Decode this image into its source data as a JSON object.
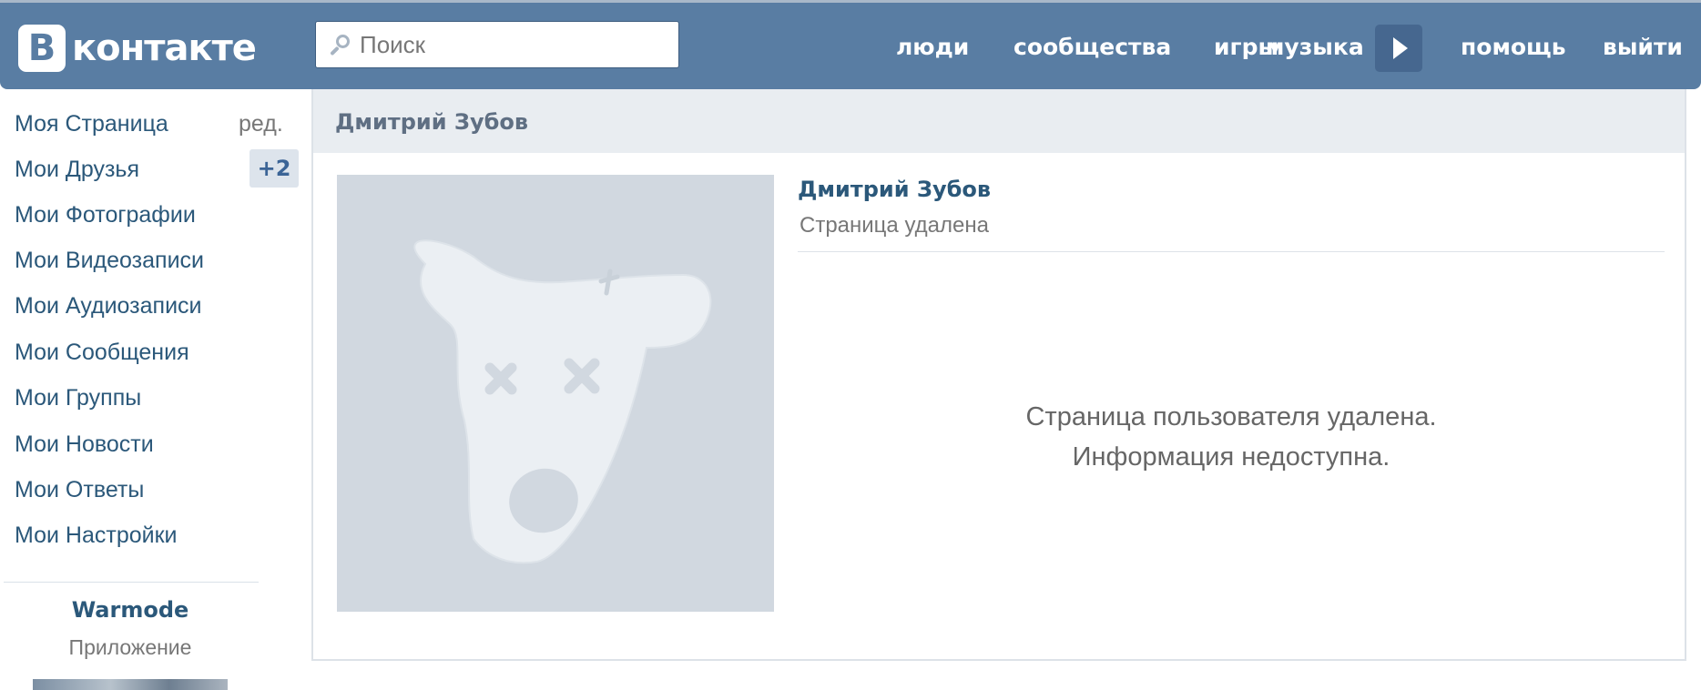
{
  "header": {
    "logo_letter": "В",
    "logo_text": "контакте",
    "search": {
      "placeholder": "Поиск"
    },
    "nav": {
      "people": "люди",
      "communities": "сообщества",
      "games": "игры",
      "music": "музыка",
      "help": "помощь",
      "logout": "выйти"
    },
    "play_icon": "play-icon"
  },
  "sidebar": {
    "items": [
      {
        "label": "Моя Страница"
      },
      {
        "label": "Мои Друзья"
      },
      {
        "label": "Мои Фотографии"
      },
      {
        "label": "Мои Видеозаписи"
      },
      {
        "label": "Мои Аудиозаписи"
      },
      {
        "label": "Мои Сообщения"
      },
      {
        "label": "Мои Группы"
      },
      {
        "label": "Мои Новости"
      },
      {
        "label": "Мои Ответы"
      },
      {
        "label": "Мои Настройки"
      }
    ],
    "edit_label": "ред.",
    "friends_badge": "+2",
    "app": {
      "name": "Warmode",
      "type": "Приложение"
    }
  },
  "main": {
    "header_title": "Дмитрий Зубов",
    "profile": {
      "name": "Дмитрий Зубов",
      "status": "Страница удалена"
    },
    "deleted_message": {
      "line1": "Страница пользователя удалена.",
      "line2": "Информация недоступна."
    }
  },
  "colors": {
    "header_bg": "#597da3",
    "link": "#2b587a",
    "avatar_bg": "#d1d8e0",
    "avatar_figure": "#ebeff3"
  }
}
